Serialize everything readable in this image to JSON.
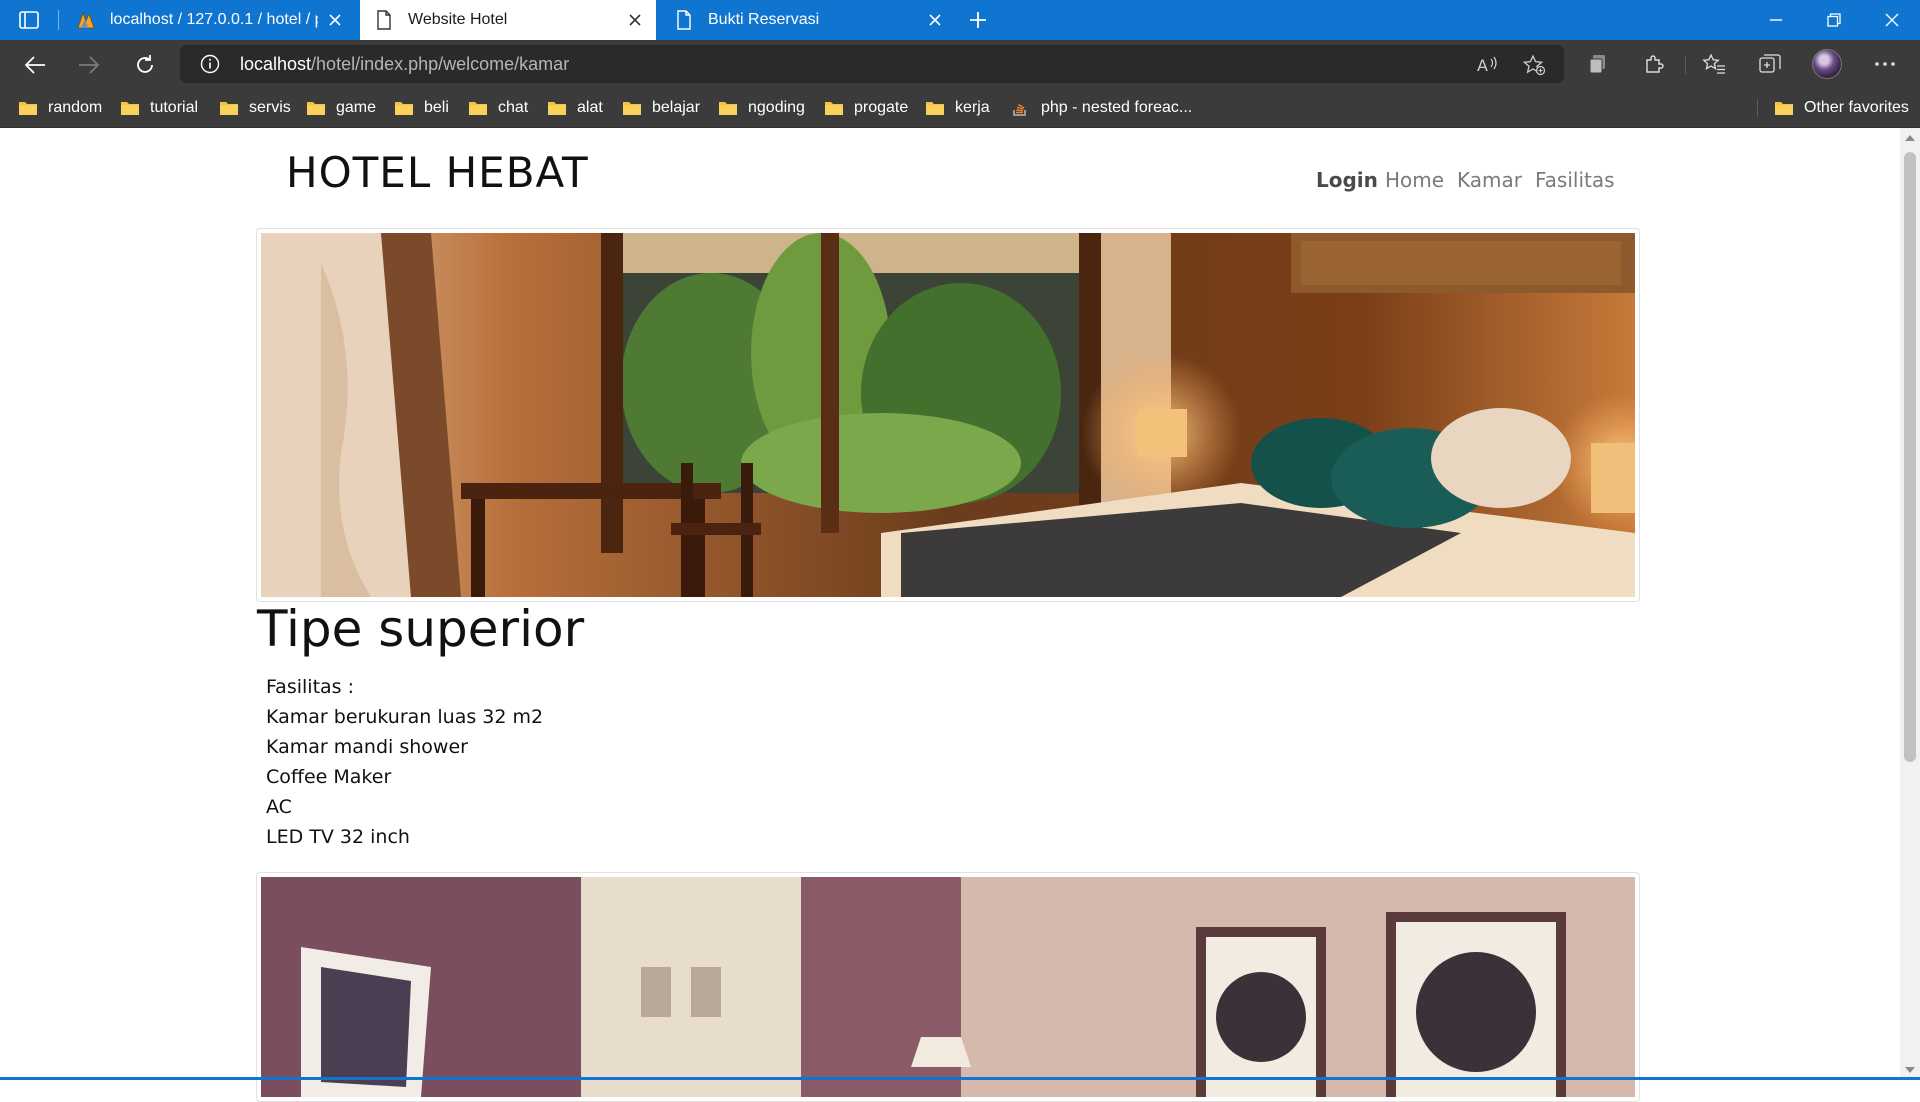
{
  "browser": {
    "tabs": [
      {
        "title": "localhost / 127.0.0.1 / hotel / pe",
        "icon": "phpmyadmin-icon",
        "active": false
      },
      {
        "title": "Website Hotel",
        "icon": "page-icon",
        "active": true
      },
      {
        "title": "Bukti Reservasi",
        "icon": "page-icon",
        "active": false
      }
    ],
    "address": {
      "host": "localhost",
      "path": "/hotel/index.php/welcome/kamar"
    },
    "bookmarks": [
      {
        "label": "random",
        "icon": "folder-icon"
      },
      {
        "label": "tutorial",
        "icon": "folder-icon"
      },
      {
        "label": "servis",
        "icon": "folder-icon"
      },
      {
        "label": "game",
        "icon": "folder-icon"
      },
      {
        "label": "beli",
        "icon": "folder-icon"
      },
      {
        "label": "chat",
        "icon": "folder-icon"
      },
      {
        "label": "alat",
        "icon": "folder-icon"
      },
      {
        "label": "belajar",
        "icon": "folder-icon"
      },
      {
        "label": "ngoding",
        "icon": "folder-icon"
      },
      {
        "label": "progate",
        "icon": "folder-icon"
      },
      {
        "label": "kerja",
        "icon": "folder-icon"
      },
      {
        "label": "php - nested foreac...",
        "icon": "stackoverflow-icon"
      }
    ],
    "other_favorites": "Other favorites",
    "colors": {
      "tabbar": "#0f75d1",
      "toolbar": "#3b3b3b",
      "folder": "#f3c443"
    }
  },
  "site": {
    "title": "HOTEL HEBAT",
    "nav": {
      "login": "Login",
      "home": "Home",
      "kamar": "Kamar",
      "fasilitas": "Fasilitas"
    }
  },
  "rooms": [
    {
      "name": "Tipe superior",
      "image": "hotel-room-photo-warm",
      "facilities_label": "Fasilitas :",
      "facilities": [
        "Kamar berukuran luas 32 m2",
        "Kamar mandi shower",
        "Coffee Maker",
        "AC",
        "LED TV 32 inch"
      ]
    },
    {
      "image": "hotel-room-photo-purple"
    }
  ]
}
